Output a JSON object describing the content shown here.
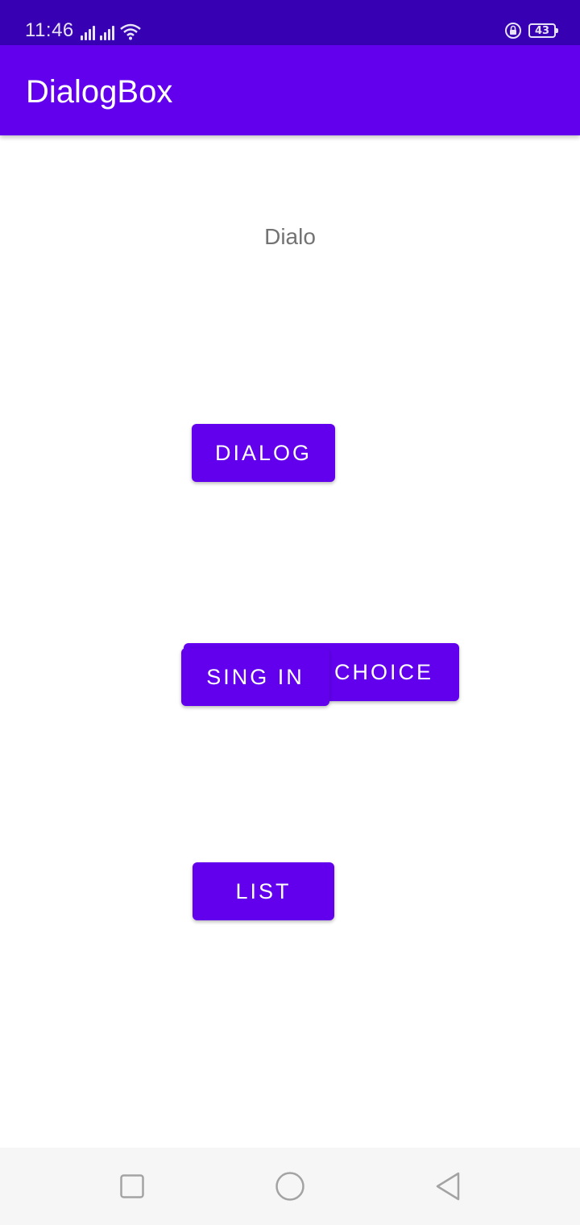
{
  "status_bar": {
    "time": "11:46",
    "battery_level": "43",
    "icons": [
      "signal-icon",
      "signal-icon",
      "wifi-icon",
      "rotation-lock-icon",
      "battery-icon"
    ]
  },
  "app_bar": {
    "title": "DialogBox"
  },
  "main": {
    "label": "Dialo",
    "buttons": {
      "dialog": "DIALOG",
      "choice": "CHOICE",
      "sign_in": "SING IN",
      "list": "LIST"
    }
  },
  "nav_bar": {
    "icons": [
      "recents-square-icon",
      "home-circle-icon",
      "back-triangle-icon"
    ]
  },
  "colors": {
    "status_bar": "#3700B3",
    "primary": "#6200EE",
    "text_gray": "#737373",
    "nav_bar": "#f6f6f6"
  }
}
